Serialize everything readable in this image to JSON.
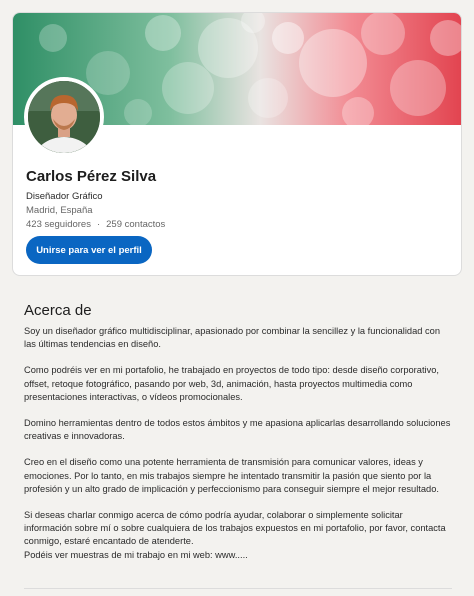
{
  "profile": {
    "name": "Carlos Pérez Silva",
    "headline": "Diseñador Gráfico",
    "location": "Madrid, España",
    "followers": "423 seguidores",
    "separator": "·",
    "connections": "259 contactos",
    "join_button": "Unirse para ver el perfil"
  },
  "about": {
    "title": "Acerca de",
    "paragraphs": [
      "Soy un diseñador gráfico multidisciplinar, apasionado por combinar la sencillez y la funcionalidad con las últimas tendencias en diseño.",
      "Como podréis ver en mi portafolio, he trabajado en proyectos de todo tipo: desde diseño corporativo, offset, retoque fotográfico, pasando por web, 3d, animación, hasta proyectos multimedia como presentaciones interactivas, o vídeos promocionales.",
      "Domino herramientas dentro de todos estos ámbitos y me apasiona aplicarlas desarrollando soluciones creativas e innovadoras.",
      "Creo en el diseño como una potente herramienta de transmisión para comunicar valores, ideas y emociones. Por lo tanto, en mis trabajos siempre he intentado transmitir la pasión que siento por la profesión y un alto grado de implicación y perfeccionismo para conseguir siempre el mejor resultado.",
      "Si deseas charlar conmigo acerca de cómo podría ayudar, colaborar o simplemente solicitar información sobre mí o sobre cualquiera de los trabajos expuestos en mi portafolio, por favor, contacta conmigo, estaré encantado de atenderte.",
      "Podéis ver muestras de mi trabajo en mi web: www....."
    ]
  },
  "colors": {
    "accent": "#0a66c2",
    "cover_green": "#3f9a6e",
    "cover_red": "#e24a55"
  }
}
